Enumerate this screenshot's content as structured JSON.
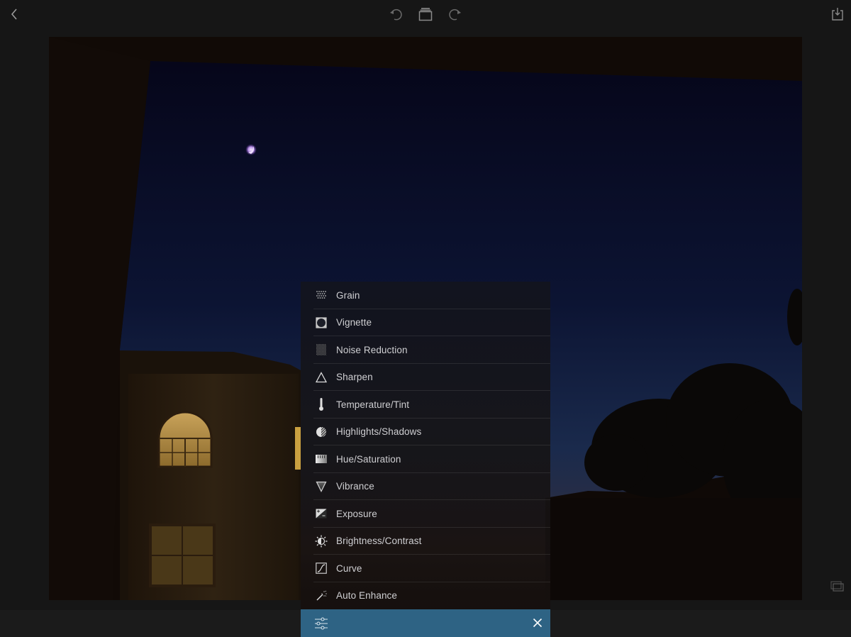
{
  "toolbar": {
    "back_icon": "chevron-left-icon",
    "undo_icon": "undo-icon",
    "history_icon": "stacked-layers-icon",
    "redo_icon": "redo-icon",
    "export_icon": "share-download-icon",
    "icon_color": "#8a8a8a"
  },
  "photo": {
    "description": "Night sky over a building with lit windows and a silhouetted tree, crescent moon visible"
  },
  "compare": {
    "icon": "compare-icon"
  },
  "adjustments_menu": {
    "items": [
      {
        "label": "Grain",
        "icon": "grain-icon"
      },
      {
        "label": "Vignette",
        "icon": "vignette-icon"
      },
      {
        "label": "Noise Reduction",
        "icon": "noise-reduction-icon"
      },
      {
        "label": "Sharpen",
        "icon": "sharpen-triangle-icon"
      },
      {
        "label": "Temperature/Tint",
        "icon": "thermometer-icon"
      },
      {
        "label": "Highlights/Shadows",
        "icon": "highlights-shadows-icon"
      },
      {
        "label": "Hue/Saturation",
        "icon": "hue-saturation-icon"
      },
      {
        "label": "Vibrance",
        "icon": "vibrance-triangle-icon"
      },
      {
        "label": "Exposure",
        "icon": "exposure-icon"
      },
      {
        "label": "Brightness/Contrast",
        "icon": "brightness-contrast-icon"
      },
      {
        "label": "Curve",
        "icon": "curve-icon"
      },
      {
        "label": "Auto Enhance",
        "icon": "magic-wand-icon"
      }
    ],
    "footer": {
      "sliders_icon": "adjustments-sliders-icon",
      "close_icon": "close-icon",
      "accent_color": "#2e6384"
    }
  }
}
